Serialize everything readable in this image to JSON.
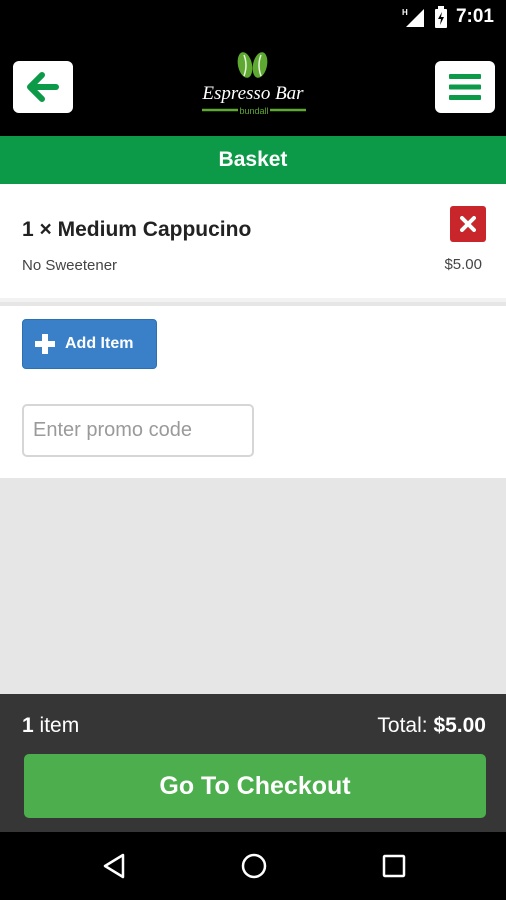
{
  "status_bar": {
    "time": "7:01",
    "icons": [
      "signal-icon",
      "battery-icon"
    ]
  },
  "header": {
    "logo_text": "Espresso Bar",
    "logo_subtext": "bundall",
    "back_icon": "arrow-left-icon",
    "menu_icon": "hamburger-menu-icon"
  },
  "page": {
    "title": "Basket"
  },
  "basket": {
    "items": [
      {
        "title": "1 × Medium Cappucino",
        "note": "No Sweetener",
        "price": "$5.00",
        "remove_icon": "close-icon"
      }
    ]
  },
  "actions": {
    "add_item_label": "Add Item",
    "add_icon": "plus-icon",
    "promo_placeholder": "Enter promo code"
  },
  "footer": {
    "count_number": "1",
    "count_word": "item",
    "total_label": "Total:",
    "total_value": "$5.00",
    "checkout_label": "Go To Checkout"
  },
  "colors": {
    "brand_green": "#0c9a48",
    "checkout_green": "#4cae4c",
    "add_blue": "#3a80c9",
    "remove_red": "#c8262b",
    "footer_dark": "#363636"
  },
  "nav": {
    "icons": [
      "back-triangle-icon",
      "home-circle-icon",
      "recents-square-icon"
    ]
  }
}
